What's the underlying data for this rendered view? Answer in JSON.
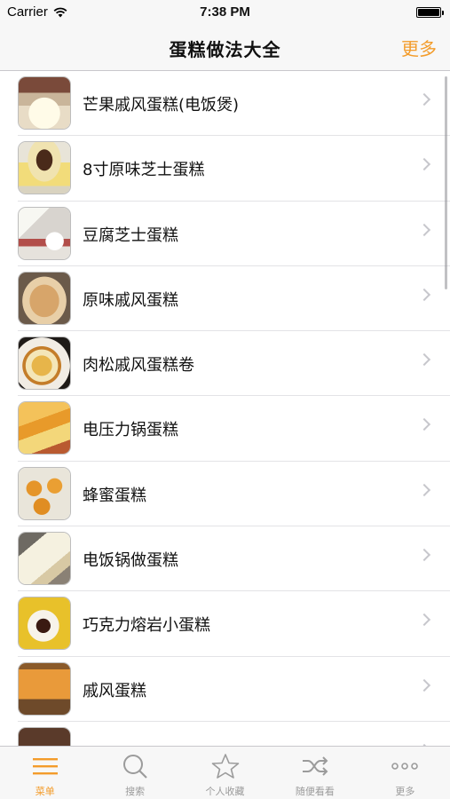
{
  "status_bar": {
    "carrier": "Carrier",
    "time": "7:38 PM"
  },
  "nav": {
    "title": "蛋糕做法大全",
    "more": "更多"
  },
  "colors": {
    "accent": "#f39c2b",
    "tab_inactive": "#9b9b9b",
    "chevron": "#c7c7cc"
  },
  "recipes": [
    {
      "label": "芒果戚风蛋糕(电饭煲)",
      "thumb": "cake-slice-photo"
    },
    {
      "label": "8寸原味芝士蛋糕",
      "thumb": "cheesecake-photo"
    },
    {
      "label": "豆腐芝士蛋糕",
      "thumb": "tofu-cheesecake-photo"
    },
    {
      "label": "原味戚风蛋糕",
      "thumb": "chiffon-cake-photo"
    },
    {
      "label": "肉松戚风蛋糕卷",
      "thumb": "cake-roll-photo"
    },
    {
      "label": "电压力锅蛋糕",
      "thumb": "pressure-cooker-cake-photo"
    },
    {
      "label": "蜂蜜蛋糕",
      "thumb": "honey-cake-photo"
    },
    {
      "label": "电饭锅做蛋糕",
      "thumb": "rice-cooker-cake-photo"
    },
    {
      "label": "巧克力熔岩小蛋糕",
      "thumb": "lava-cake-photo"
    },
    {
      "label": "戚风蛋糕",
      "thumb": "chiffon-photo"
    },
    {
      "label": "",
      "thumb": "partial-row-photo"
    }
  ],
  "tabs": [
    {
      "label": "菜单",
      "icon": "menu-icon",
      "active": true
    },
    {
      "label": "搜索",
      "icon": "search-icon",
      "active": false
    },
    {
      "label": "个人收藏",
      "icon": "star-icon",
      "active": false
    },
    {
      "label": "随便看看",
      "icon": "shuffle-icon",
      "active": false
    },
    {
      "label": "更多",
      "icon": "more-dots-icon",
      "active": false
    }
  ]
}
